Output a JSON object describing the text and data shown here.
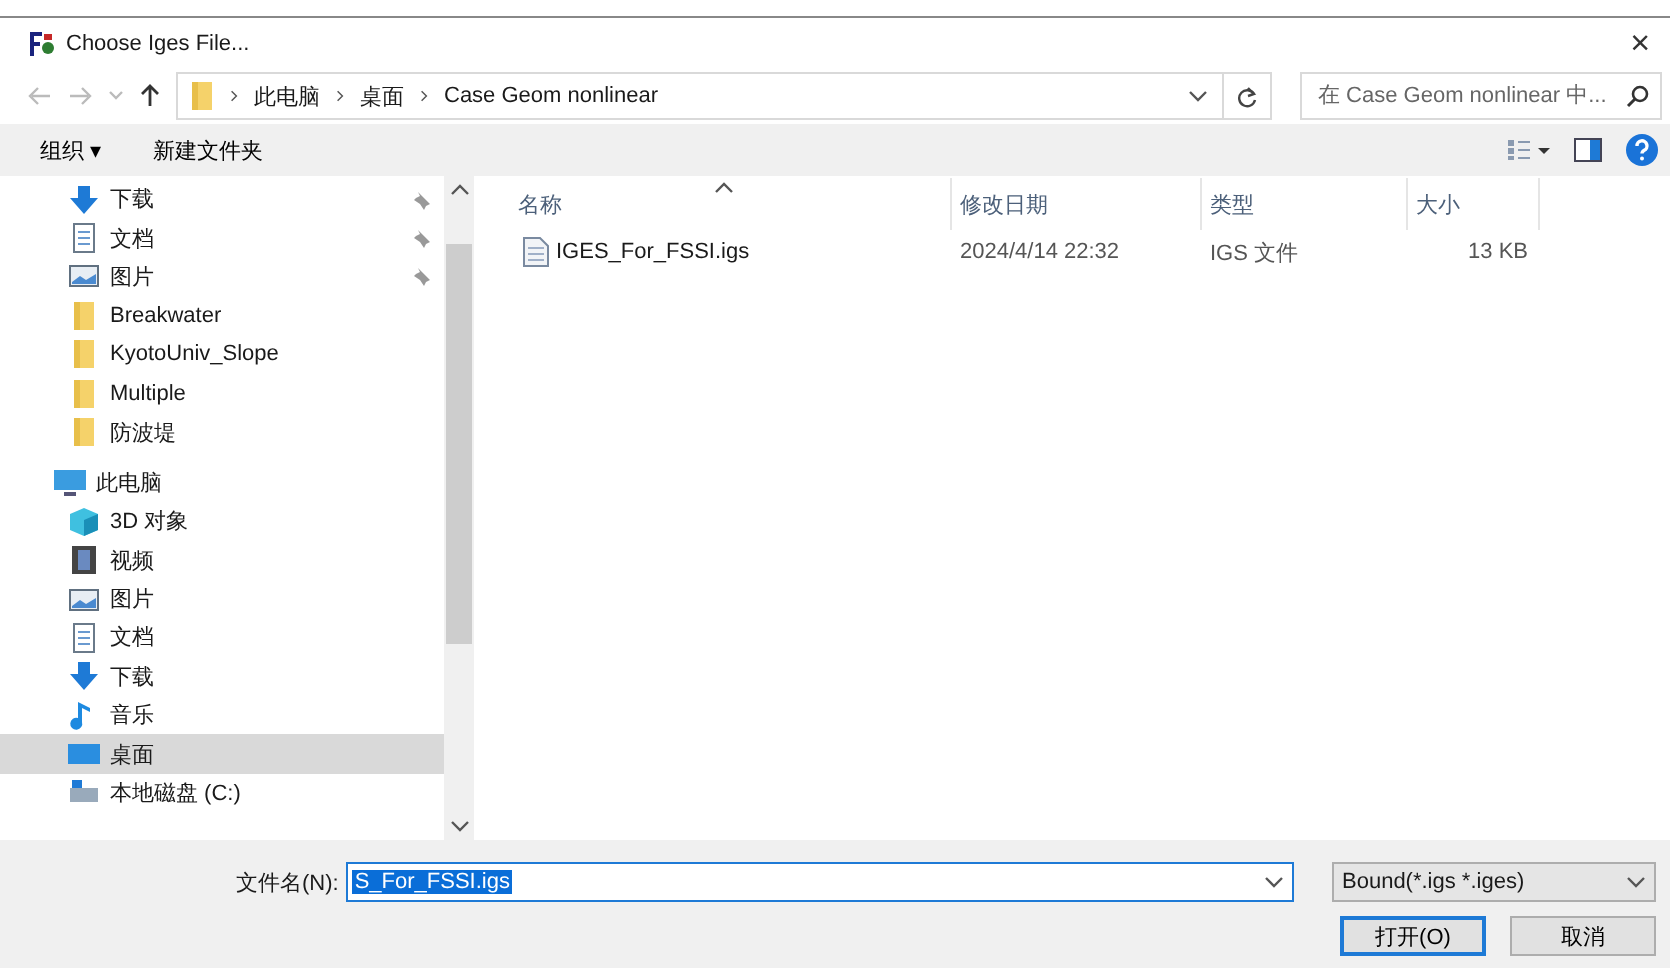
{
  "window": {
    "title": "Choose Iges File...",
    "close": "×"
  },
  "address": {
    "path": [
      "此电脑",
      "桌面",
      "Case Geom nonlinear"
    ],
    "search_placeholder": "在 Case Geom nonlinear 中..."
  },
  "toolbar": {
    "organize": "组织 ▾",
    "new_folder": "新建文件夹"
  },
  "nav": [
    {
      "label": "下载",
      "kind": "download",
      "pinned": true,
      "selected": false
    },
    {
      "label": "文档",
      "kind": "docs",
      "pinned": true,
      "selected": false
    },
    {
      "label": "图片",
      "kind": "pictures",
      "pinned": true,
      "selected": false
    },
    {
      "label": "Breakwater",
      "kind": "folder",
      "pinned": false,
      "selected": false
    },
    {
      "label": "KyotoUniv_Slope",
      "kind": "folder",
      "pinned": false,
      "selected": false
    },
    {
      "label": "Multiple",
      "kind": "folder",
      "pinned": false,
      "selected": false
    },
    {
      "label": "防波堤",
      "kind": "folder",
      "pinned": false,
      "selected": false
    },
    {
      "label": "此电脑",
      "kind": "pc",
      "pinned": false,
      "selected": false
    },
    {
      "label": "3D 对象",
      "kind": "object",
      "pinned": false,
      "selected": false
    },
    {
      "label": "视频",
      "kind": "video",
      "pinned": false,
      "selected": false
    },
    {
      "label": "图片",
      "kind": "pictures",
      "pinned": false,
      "selected": false
    },
    {
      "label": "文档",
      "kind": "docs",
      "pinned": false,
      "selected": false
    },
    {
      "label": "下载",
      "kind": "download",
      "pinned": false,
      "selected": false
    },
    {
      "label": "音乐",
      "kind": "music",
      "pinned": false,
      "selected": false
    },
    {
      "label": "桌面",
      "kind": "desktop",
      "pinned": false,
      "selected": true
    },
    {
      "label": "本地磁盘 (C:)",
      "kind": "drive",
      "pinned": false,
      "selected": false
    }
  ],
  "table": {
    "columns": [
      "名称",
      "修改日期",
      "类型",
      "大小"
    ],
    "rows": [
      [
        "IGES_For_FSSI.igs",
        "2024/4/14 22:32",
        "IGS 文件",
        "13 KB"
      ]
    ]
  },
  "footer": {
    "filename_label": "文件名(N):",
    "filename_value": "S_For_FSSI.igs",
    "filter": "Bound(*.igs *.iges)",
    "open": "打开(O)",
    "cancel": "取消"
  }
}
